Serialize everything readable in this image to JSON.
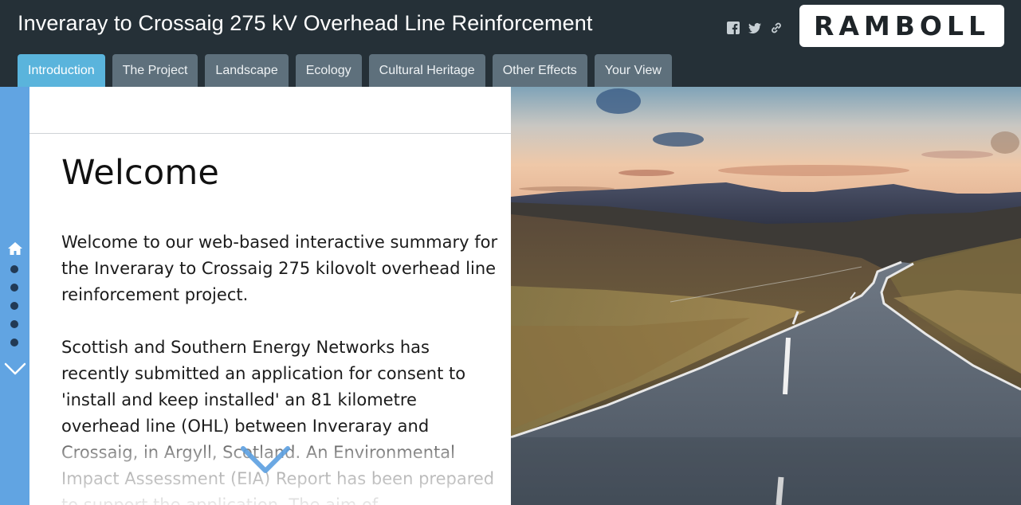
{
  "header": {
    "title": "Inveraray to Crossaig 275 kV Overhead Line Reinforcement",
    "social": [
      {
        "icon": "facebook-icon"
      },
      {
        "icon": "twitter-icon"
      },
      {
        "icon": "link-icon"
      }
    ],
    "logo": "RAMBOLL"
  },
  "tabs": [
    {
      "label": "Introduction",
      "active": true
    },
    {
      "label": "The Project",
      "active": false
    },
    {
      "label": "Landscape",
      "active": false
    },
    {
      "label": "Ecology",
      "active": false
    },
    {
      "label": "Cultural Heritage",
      "active": false
    },
    {
      "label": "Other Effects",
      "active": false
    },
    {
      "label": "Your View",
      "active": false
    }
  ],
  "sidebar": {
    "icons": [
      "home-icon",
      "chevron-down-icon"
    ],
    "dots": 5
  },
  "content": {
    "heading": "Welcome",
    "paragraph1": "Welcome to our web-based interactive summary for the Inveraray to Crossaig 275 kilovolt overhead line reinforcement project.",
    "paragraph2": "Scottish and Southern Energy Networks has recently submitted an application for consent to 'install and keep installed' an 81 kilometre overhead line (OHL) between Inveraray and Crossaig, in Argyll, Scotland. An Environmental Impact Assessment (EIA) Report has been prepared to support the application. The aim of"
  },
  "colors": {
    "header_bg": "#253037",
    "tab_bg": "#5e707c",
    "tab_active_bg": "#5ab4dc",
    "rail_bg": "#61a4e2",
    "accent": "#5b9fe0"
  }
}
